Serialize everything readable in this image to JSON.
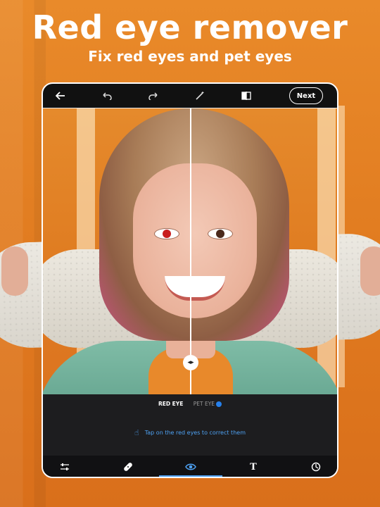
{
  "promo": {
    "title": "Red eye remover",
    "subtitle": "Fix red eyes and pet eyes"
  },
  "topbar": {
    "back_icon": "arrow-left-icon",
    "undo_icon": "undo-icon",
    "redo_icon": "redo-icon",
    "magic_icon": "magic-wand-icon",
    "compare_icon": "compare-icon",
    "next_label": "Next"
  },
  "editor": {
    "mode_tabs": [
      {
        "label": "RED EYE",
        "active": true
      },
      {
        "label": "PET EYE",
        "active": false,
        "badge": "new"
      }
    ],
    "hint": "Tap on the red eyes to correct them"
  },
  "toolbar": {
    "tools": [
      {
        "name": "adjust-sliders-icon",
        "active": false
      },
      {
        "name": "healing-bandage-icon",
        "active": false
      },
      {
        "name": "eye-icon",
        "active": true
      },
      {
        "name": "text-icon",
        "active": false,
        "glyph": "T"
      },
      {
        "name": "sticker-icon",
        "active": false
      }
    ]
  },
  "colors": {
    "background_orange": "#e07a1f",
    "accent_blue": "#4ea1f2",
    "panel_dark": "#1d1d1f"
  }
}
